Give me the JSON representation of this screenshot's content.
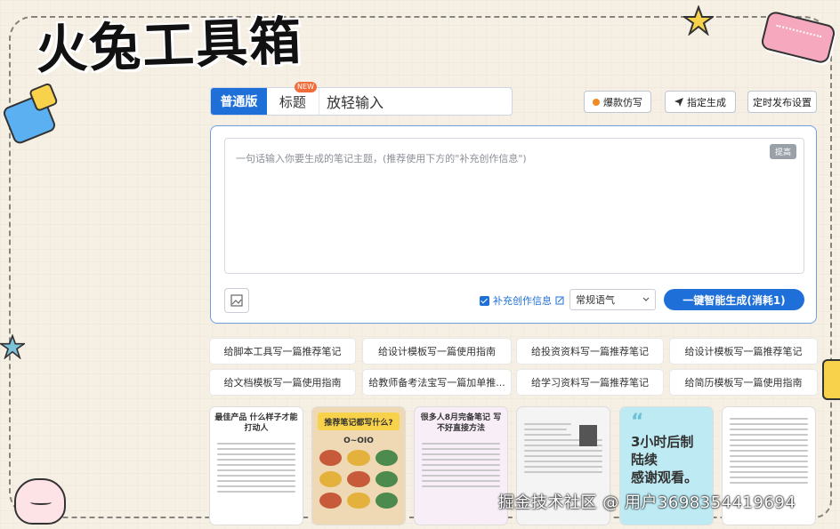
{
  "app": {
    "title": "火兔工具箱"
  },
  "mode_bar": {
    "tabs": [
      {
        "label": "普通版",
        "active": true
      },
      {
        "label": "标题",
        "badge": "NEW"
      }
    ],
    "title_input_value": "放轻输入"
  },
  "top_buttons": {
    "imitate": "爆款仿写",
    "fixed": "指定生成",
    "schedule": "定时发布设置"
  },
  "editor": {
    "placeholder": "一句话输入你要生成的笔记主题，(推荐使用下方的\"补充创作信息\")",
    "tag": "提高",
    "supplement_label": "补充创作信息",
    "tone_value": "常规语气",
    "generate_label": "一键智能生成(消耗1)"
  },
  "suggestions": [
    "给脚本工具写一篇推荐笔记",
    "给设计模板写一篇使用指南",
    "给投资资料写一篇推荐笔记",
    "给设计模板写一篇推荐笔记",
    "给文档模板写一篇使用指南",
    "给教师备考法宝写一篇加单推...",
    "给学习资料写一篇推荐笔记",
    "给简历模板写一篇使用指南"
  ],
  "thumbnails": {
    "t1_title": "最佳产品 什么样子才能打动人",
    "t2_title": "推荐笔记都写什么?",
    "t2_sub": "O~OIO",
    "t3_title": "很多人8月完备笔记 写不好直接方法",
    "t5_quote": "“",
    "t5_text": "3小时后制\n陆续\n感谢观看。"
  },
  "watermark": "掘金技术社区 @ 用户3698354419694",
  "colors": {
    "accent": "#1f6fd8",
    "badge": "#f26b3a",
    "background": "#f6f0e4"
  }
}
